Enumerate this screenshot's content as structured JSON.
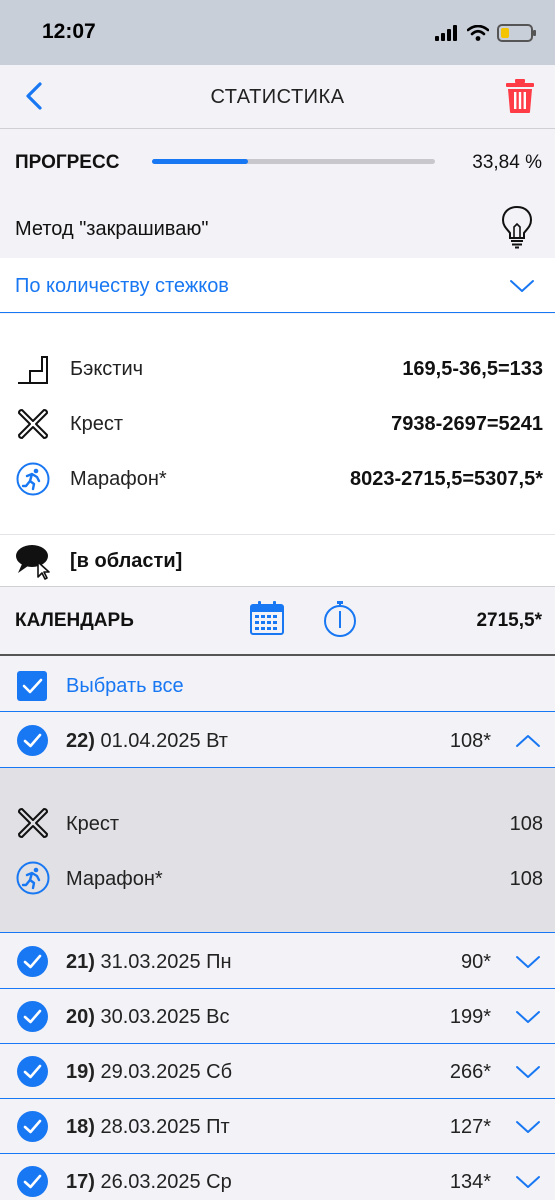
{
  "status_bar": {
    "time": "12:07"
  },
  "nav": {
    "title": "СТАТИСТИКА"
  },
  "progress": {
    "label": "ПРОГРЕСС",
    "value_text": "33,84 %",
    "fraction": 0.3384
  },
  "method": {
    "label": "Метод \"закрашиваю\""
  },
  "dropdown": {
    "value": "По количеству стежков"
  },
  "stats": [
    {
      "icon": "backstitch-icon",
      "label": "Бэкстич",
      "value": "169,5-36,5=133"
    },
    {
      "icon": "cross-stitch-icon",
      "label": "Крест",
      "value": "7938-2697=5241"
    },
    {
      "icon": "marathon-runner-icon",
      "label": "Марафон*",
      "value": "8023-2715,5=5307,5*"
    }
  ],
  "area": {
    "label": "[в области]"
  },
  "calendar": {
    "label": "КАЛЕНДАРЬ",
    "total": "2715,5*"
  },
  "select_all": {
    "label": "Выбрать все"
  },
  "days": [
    {
      "num": "22)",
      "date": "01.04.2025 Вт",
      "count": "108*",
      "expanded": true
    },
    {
      "num": "21)",
      "date": "31.03.2025 Пн",
      "count": "90*",
      "expanded": false
    },
    {
      "num": "20)",
      "date": "30.03.2025 Вс",
      "count": "199*",
      "expanded": false
    },
    {
      "num": "19)",
      "date": "29.03.2025 Сб",
      "count": "266*",
      "expanded": false
    },
    {
      "num": "18)",
      "date": "28.03.2025 Пт",
      "count": "127*",
      "expanded": false
    },
    {
      "num": "17)",
      "date": "26.03.2025 Ср",
      "count": "134*",
      "expanded": false
    }
  ],
  "day_details": [
    {
      "icon": "cross-stitch-icon",
      "label": "Крест",
      "value": "108"
    },
    {
      "icon": "marathon-runner-icon",
      "label": "Марафон*",
      "value": "108"
    }
  ],
  "colors": {
    "accent": "#1877f2",
    "delete": "#ff3b46",
    "progress_track": "#c7c7cc"
  }
}
